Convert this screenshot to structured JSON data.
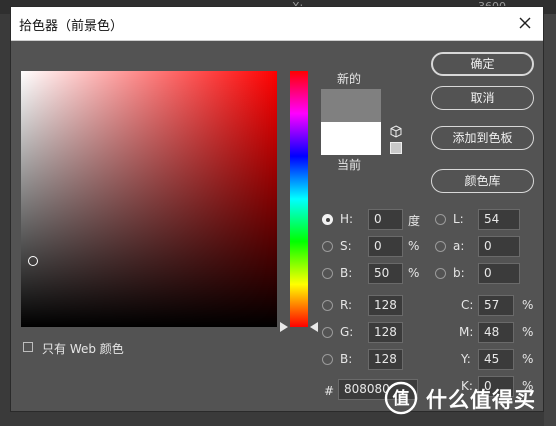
{
  "background": {
    "tab_x_label": "X:",
    "tab_value": "3600"
  },
  "dialog": {
    "title": "拾色器（前景色）",
    "new_label": "新的",
    "current_label": "当前",
    "new_color": "#808080",
    "current_color": "#ffffff"
  },
  "buttons": {
    "ok": "确定",
    "cancel": "取消",
    "add_swatch": "添加到色板",
    "color_library": "颜色库"
  },
  "hsb": {
    "h_label": "H:",
    "h_value": "0",
    "h_unit": "度",
    "s_label": "S:",
    "s_value": "0",
    "s_unit": "%",
    "b_label": "B:",
    "b_value": "50",
    "b_unit": "%"
  },
  "lab": {
    "l_label": "L:",
    "l_value": "54",
    "a_label": "a:",
    "a_value": "0",
    "b_label": "b:",
    "b_value": "0"
  },
  "rgb": {
    "r_label": "R:",
    "r_value": "128",
    "g_label": "G:",
    "g_value": "128",
    "b_label": "B:",
    "b_value": "128"
  },
  "cmyk": {
    "c_label": "C:",
    "c_value": "57",
    "c_unit": "%",
    "m_label": "M:",
    "m_value": "48",
    "m_unit": "%",
    "y_label": "Y:",
    "y_value": "45",
    "y_unit": "%",
    "k_label": "K:",
    "k_value": "0",
    "k_unit": "%"
  },
  "hex": {
    "label": "#",
    "value": "808080"
  },
  "web_only": {
    "label": "只有 Web 颜色",
    "checked": false
  },
  "watermark": {
    "text": "什么值得买"
  }
}
